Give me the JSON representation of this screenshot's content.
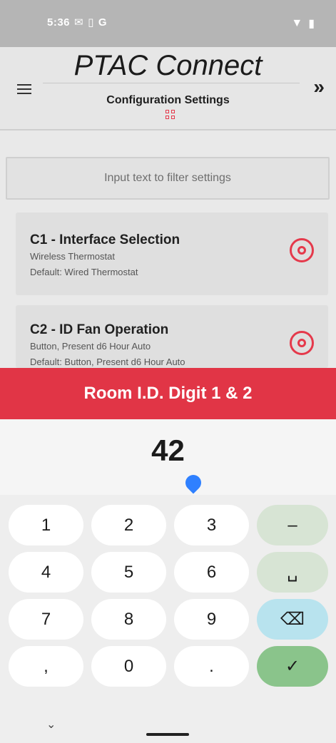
{
  "status": {
    "time": "5:36",
    "icons": [
      "mail",
      "battery",
      "G"
    ],
    "right_icons": [
      "wifi",
      "battery"
    ]
  },
  "header": {
    "title": "PTAC Connect",
    "subtitle": "Configuration Settings",
    "menu_icon": "hamburger-menu-icon",
    "forward_icon": "double-chevron-right-icon"
  },
  "filter": {
    "placeholder": "Input text to filter settings"
  },
  "settings": [
    {
      "title": "C1 - Interface Selection",
      "value": "Wireless Thermostat",
      "default": "Default: Wired Thermostat"
    },
    {
      "title": "C2 - ID Fan Operation",
      "value": "Button, Present d6 Hour Auto",
      "default": "Default: Button, Present d6 Hour Auto"
    }
  ],
  "dialog": {
    "title": "Room I.D. Digit 1 & 2",
    "value": "42"
  },
  "keyboard": {
    "rows": [
      [
        "1",
        "2",
        "3",
        "–"
      ],
      [
        "4",
        "5",
        "6",
        "␣"
      ],
      [
        "7",
        "8",
        "9",
        "⌫"
      ],
      [
        ",",
        "0",
        ".",
        "✓"
      ]
    ]
  },
  "colors": {
    "accent": "#e13546",
    "status_bar": "#b5b5b5"
  }
}
